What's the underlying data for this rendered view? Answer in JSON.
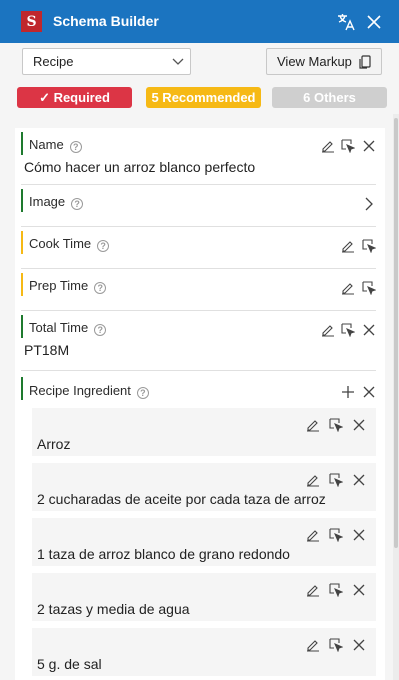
{
  "header": {
    "app_icon_letter": "S",
    "title": "Schema Builder",
    "icons": [
      "translate-icon",
      "close-icon"
    ]
  },
  "toolbar": {
    "schema_type": "Recipe",
    "view_markup_label": "View Markup"
  },
  "filters": {
    "required": "✓ Required",
    "recommended": "5 Recommended",
    "others": "6 Others"
  },
  "fields": [
    {
      "label": "Name",
      "value": "Cómo hacer un arroz blanco perfecto",
      "status": "required"
    },
    {
      "label": "Image",
      "value": "",
      "status": "required"
    },
    {
      "label": "Cook Time",
      "value": "",
      "status": "recommended"
    },
    {
      "label": "Prep Time",
      "value": "",
      "status": "recommended"
    },
    {
      "label": "Total Time",
      "value": "PT18M",
      "status": "required"
    },
    {
      "label": "Recipe Ingredient",
      "value": "",
      "status": "required"
    }
  ],
  "ingredients": [
    "Arroz",
    "2 cucharadas de aceite por cada taza de arroz",
    "1 taza de arroz blanco de grano redondo",
    "2 tazas y media de agua",
    "5 g. de sal"
  ],
  "help_glyph": "?",
  "colors": {
    "header": "#1b74c0",
    "required": "#dc3545",
    "recommended": "#f6b915",
    "others": "#cfcfcf",
    "required_bar": "#1e7a2e",
    "recommended_bar": "#f6b915"
  }
}
